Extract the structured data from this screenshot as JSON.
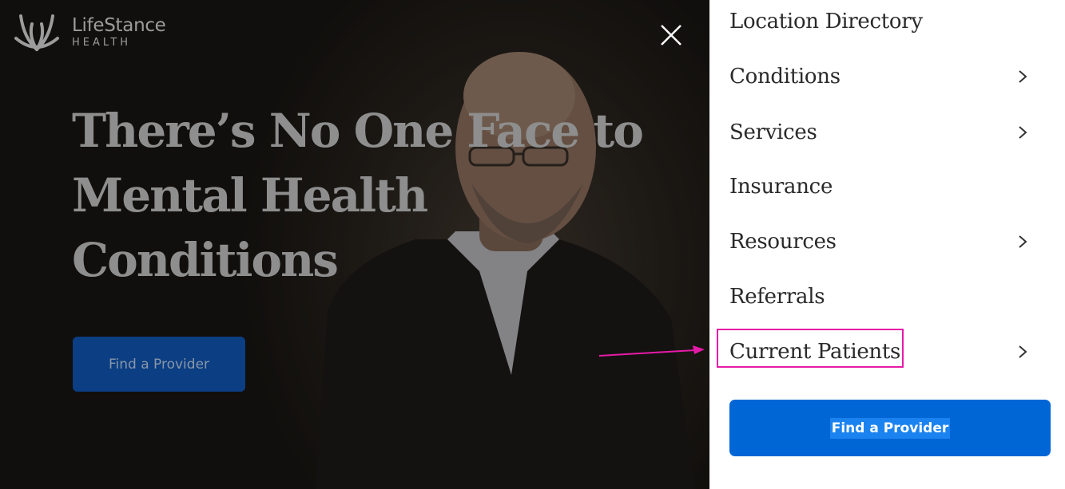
{
  "logo": {
    "line1": "LifeStance",
    "line2": "HEALTH"
  },
  "hero": {
    "headline": "There’s No One Face to Mental Health Conditions",
    "cta_label": "Find a Provider"
  },
  "menu": {
    "items": [
      {
        "label": "Location Directory",
        "has_chevron": false
      },
      {
        "label": "Conditions",
        "has_chevron": true
      },
      {
        "label": "Services",
        "has_chevron": true
      },
      {
        "label": "Insurance",
        "has_chevron": false
      },
      {
        "label": "Resources",
        "has_chevron": true
      },
      {
        "label": "Referrals",
        "has_chevron": false
      },
      {
        "label": "Current Patients",
        "has_chevron": true
      }
    ],
    "cta_label": "Find a Provider"
  },
  "icons": {
    "close": "close-icon",
    "chevron": "chevron-right-icon",
    "logo": "lifestance-logo-icon"
  },
  "colors": {
    "cta_primary": "#0066d6",
    "highlight": "#e61aa8",
    "menu_text": "#2a2a2a"
  }
}
